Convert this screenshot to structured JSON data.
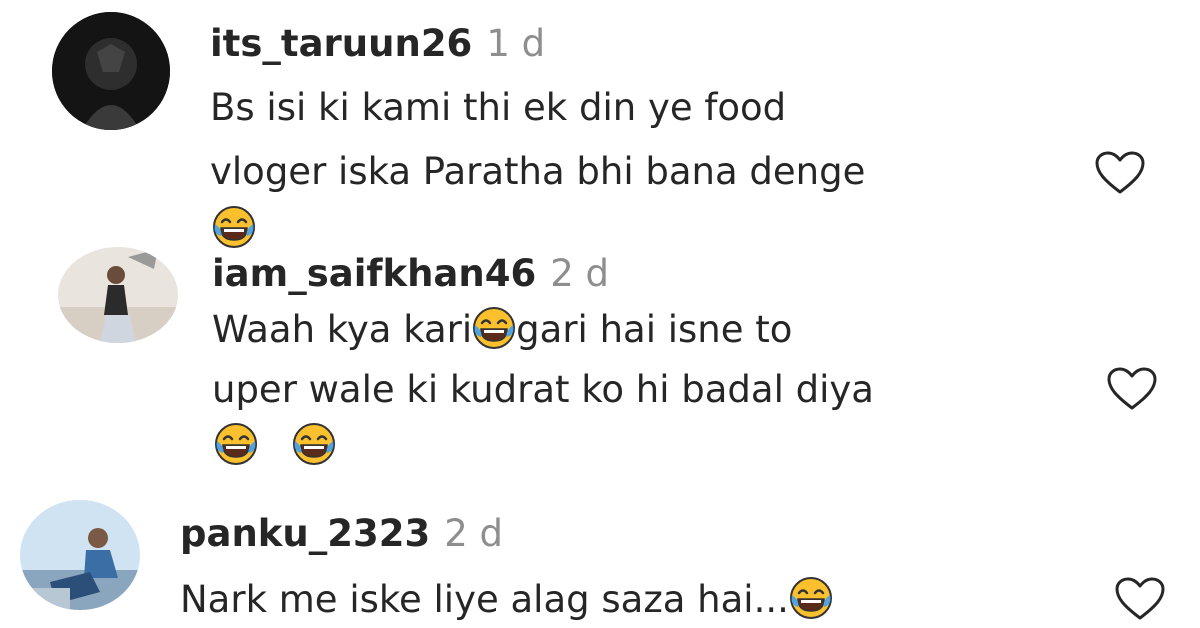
{
  "comments": [
    {
      "username": "its_taruun26",
      "time": "1 d",
      "lines": [
        "Bs isi ki kami thi ek din ye food",
        "vloger iska Paratha bhi bana denge"
      ],
      "emoji": "face-with-tears-of-joy"
    },
    {
      "username": "iam_saifkhan46",
      "time": "2 d",
      "line1_before": "Waah kya kari",
      "line1_after": "gari hai isne to",
      "line2": "uper wale ki kudrat ko hi badal diya",
      "emoji": "face-with-tears-of-joy"
    },
    {
      "username": "panku_2323",
      "time": "2 d",
      "line": "Nark me iske liye alag saza hai...",
      "emoji": "face-with-tears-of-joy"
    }
  ],
  "icons": {
    "like": "heart-outline-icon"
  },
  "colors": {
    "text": "#262626",
    "muted": "#8e8e8e",
    "emoji_face": "#fbc02d",
    "emoji_tears": "#4fa3e0"
  }
}
